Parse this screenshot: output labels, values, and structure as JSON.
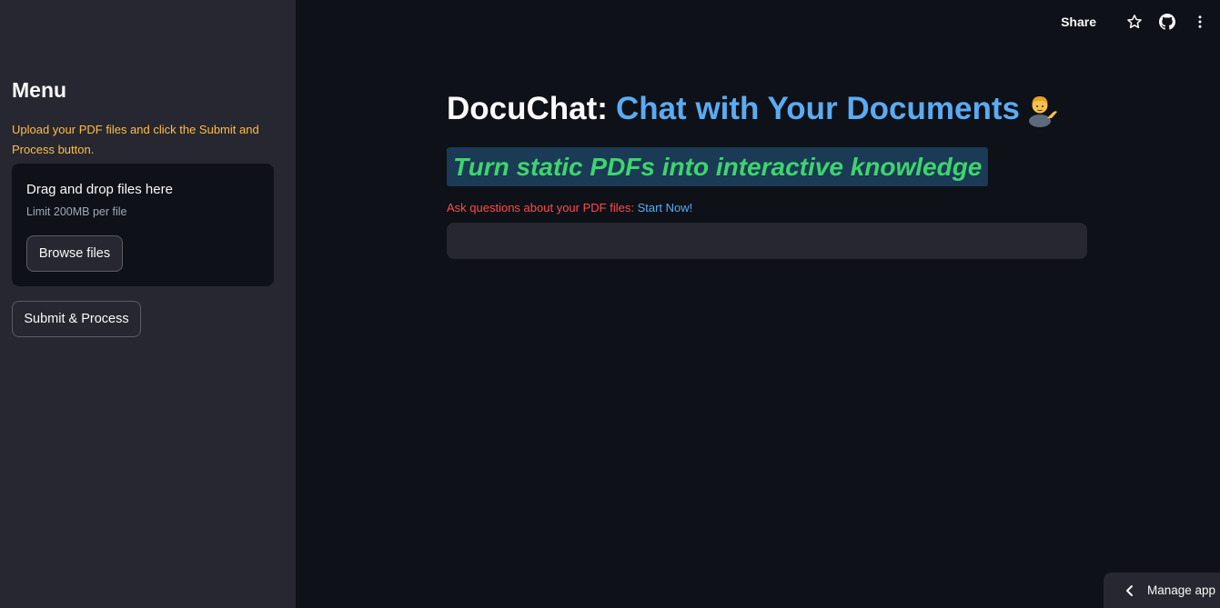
{
  "sidebar": {
    "title": "Menu",
    "instructions": "Upload your PDF files and click the Submit and Process button.",
    "uploader": {
      "title": "Drag and drop files here",
      "limit": "Limit 200MB per file",
      "browse_label": "Browse files"
    },
    "submit_label": "Submit & Process"
  },
  "toolbar": {
    "share_label": "Share",
    "icons": [
      "star-icon",
      "github-icon",
      "more-vertical-icon"
    ]
  },
  "main": {
    "title_prefix": "DocuChat:",
    "title_accent": "Chat with Your Documents",
    "title_emoji_icon": "person-tipping-hand-icon",
    "subtitle": "Turn static PDFs into interactive knowledge",
    "ask_prefix": "Ask questions about your PDF files:",
    "ask_link": "Start Now!",
    "question_value": ""
  },
  "footer": {
    "manage_label": "Manage app"
  },
  "colors": {
    "background": "#0e1117",
    "sidebar": "#262730",
    "accent_blue": "#5aabf2",
    "instructions_orange": "#ffbd45",
    "subtitle_green": "#3dd56d",
    "subtitle_bg": "#1b3a55",
    "ask_red": "#ff4b4b"
  }
}
